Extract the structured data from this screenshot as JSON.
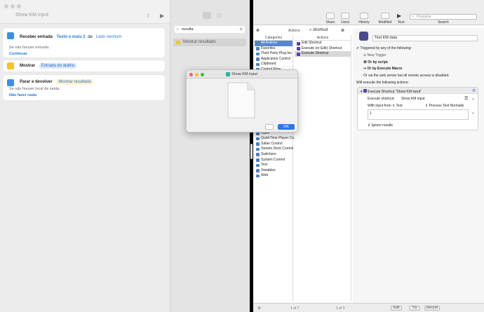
{
  "shortcuts": {
    "window_title": "Show KM input",
    "actions": [
      {
        "title": "Receber entrada",
        "input": "Texto e mais 2",
        "conj": "de",
        "source": "Lado nenhum",
        "sub": "Se não houver entrada:",
        "link": "Continuar"
      },
      {
        "title": "Mostrar",
        "pill": "Entrada do atalho"
      },
      {
        "title": "Parar e devolver",
        "pill": "Mostrar resultado",
        "sub": "Se não houver local de saída:",
        "link": "Não fazer nada"
      }
    ],
    "search_value": "resulta",
    "result_item": "Mostrar resultado"
  },
  "dialog": {
    "title": "Show KM input",
    "ok_label": "OK"
  },
  "km": {
    "toolbar": {
      "share": "Share",
      "used": "Used",
      "history": "History",
      "modified": "Modified",
      "run": "Run",
      "search": "Search",
      "search_placeholder": "Pesquisa"
    },
    "actions_search_label": "Actions",
    "actions_search_value": "shortcut",
    "categories_header": "Categories",
    "actions_header": "Actions",
    "categories_top": [
      "All Actions",
      "Favorites",
      "Third Party Plug Ins",
      "Application Control",
      "Clipboard",
      "Control Flow"
    ],
    "categories_bottom": [
      "Open",
      "QuickTime Player Co...",
      "Safari Control",
      "Stream Deck Control",
      "Switchers",
      "System Control",
      "Text",
      "Variables",
      "Web"
    ],
    "actions": [
      "Edit Shortcut",
      "Execute (or Edit) Shortcut",
      "Execute Shortcut"
    ],
    "macro": {
      "name": "Text KM data",
      "triggered": "Triggered by any of the following:",
      "new_trigger": "New Trigger",
      "or_script": "Or by script.",
      "or_macro": "Or by Execute Macro",
      "or_web": "Or via the web server but all remote access is disabled.",
      "will_execute": "Will execute the following actions:",
      "action_title": "Execute Shortcut \"Show KM input\"",
      "execute_label": "Execute shortcut:",
      "execute_value": "Show KM input",
      "with_input": "With input from",
      "input_type": "Text",
      "process": "Process Text Normally",
      "input_value": "1",
      "ignore": "Ignore results"
    },
    "bottom": {
      "cat_pages": "1 of 7",
      "act_pages": "1 of 3",
      "edit": "Edit",
      "try": "Try",
      "record": "Record"
    }
  }
}
